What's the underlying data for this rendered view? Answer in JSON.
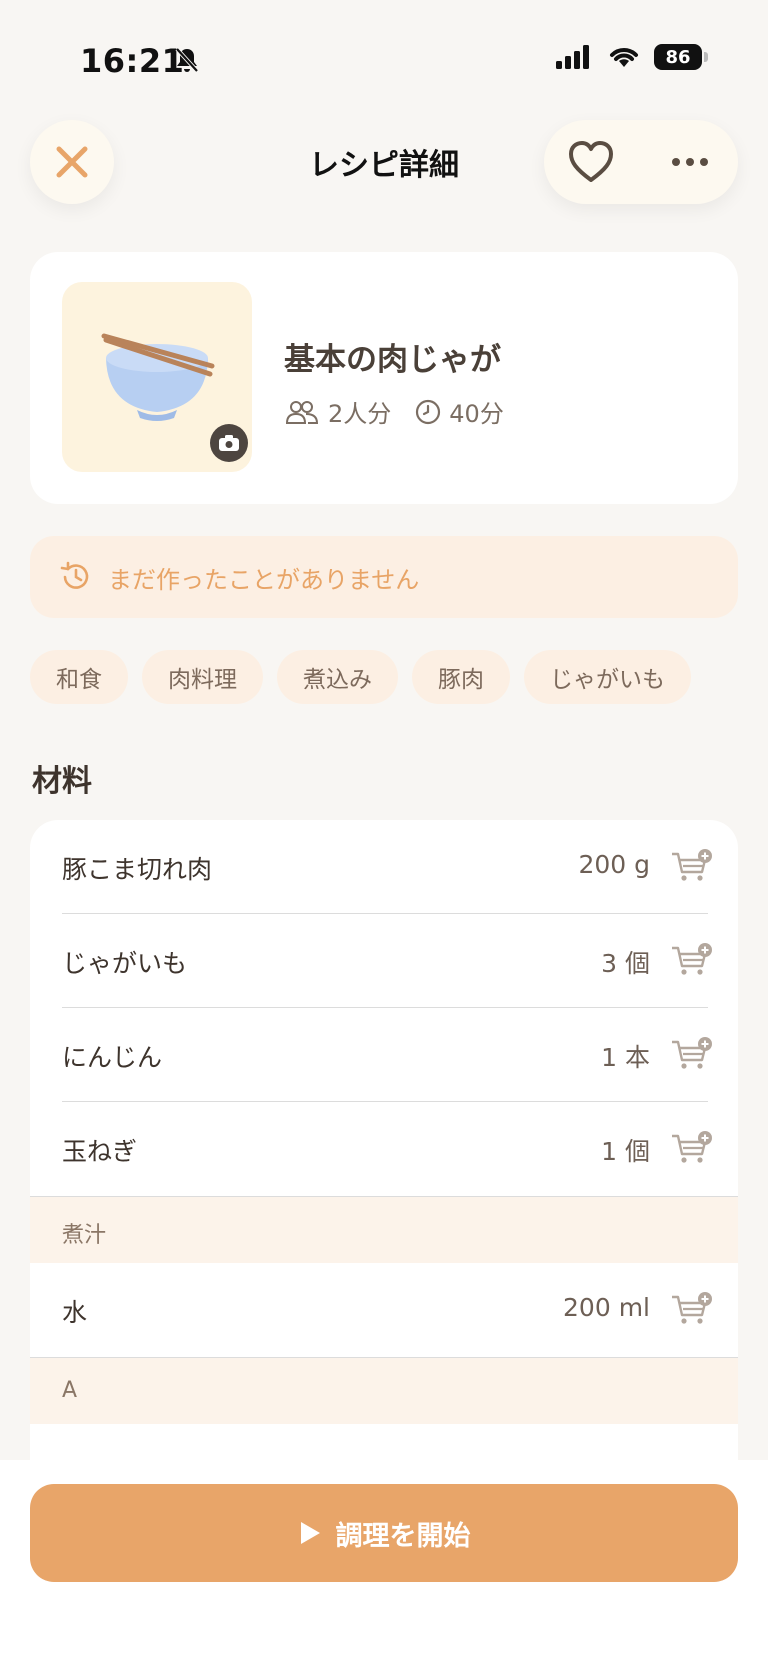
{
  "status_bar": {
    "time": "16:21",
    "battery": "86"
  },
  "header": {
    "title": "レシピ詳細"
  },
  "recipe": {
    "name": "基本の肉じゃが",
    "servings": "2人分",
    "time": "40分"
  },
  "history": {
    "text": "まだ作ったことがありません"
  },
  "tags": [
    "和食",
    "肉料理",
    "煮込み",
    "豚肉",
    "じゃがいも"
  ],
  "ingredients_section": {
    "title": "材料"
  },
  "ingredients": {
    "main": [
      {
        "name": "豚こま切れ肉",
        "qty": "200 g"
      },
      {
        "name": "じゃがいも",
        "qty": "3 個"
      },
      {
        "name": "にんじん",
        "qty": "1 本"
      },
      {
        "name": "玉ねぎ",
        "qty": "1 個"
      }
    ],
    "group1": {
      "label": "煮汁",
      "items": [
        {
          "name": "水",
          "qty": "200 ml"
        }
      ]
    },
    "group2": {
      "label": "A"
    }
  },
  "footer": {
    "start_label": "調理を開始"
  },
  "colors": {
    "accent": "#e8a569",
    "tag_bg": "#fcefe3",
    "text": "#4a4038"
  }
}
